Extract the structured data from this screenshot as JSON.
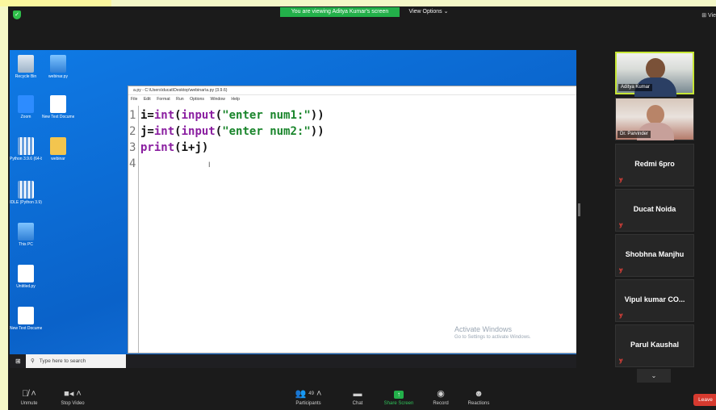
{
  "topbar": {
    "banner": "You are viewing Aditya Kumar's screen",
    "view_options": "View Options ⌄",
    "view_right": "⊞ Vie"
  },
  "desktop": {
    "icons": [
      {
        "label": "Recycle Bin"
      },
      {
        "label": "webinar.py"
      },
      {
        "label": "Zoom"
      },
      {
        "label": "New Text Document"
      },
      {
        "label": "Python 3.9.6 (64-bit)"
      },
      {
        "label": "webinar"
      },
      {
        "label": "IDLE (Python 3.9)"
      },
      {
        "label": "This PC"
      },
      {
        "label": "Untitled.py"
      },
      {
        "label": "New Text Document"
      }
    ],
    "search_placeholder": "Type here to search"
  },
  "idle": {
    "title": "a.py - C:\\Users\\ducat\\Desktop\\webinar\\a.py (3.9.6)",
    "menu": [
      "File",
      "Edit",
      "Format",
      "Run",
      "Options",
      "Window",
      "Help"
    ],
    "line_numbers": [
      "1",
      "2",
      "3",
      "4"
    ],
    "lines": {
      "l1a": "i=",
      "l1b": "int",
      "l1c": "(",
      "l1d": "input",
      "l1e": "(",
      "l1f": "\"enter num1:\"",
      "l1g": "))",
      "l2a": "j=",
      "l2b": "int",
      "l2c": "(",
      "l2d": "input",
      "l2e": "(",
      "l2f": "\"enter num2:\"",
      "l2g": "))",
      "l3a": "print",
      "l3b": "(i+j)"
    },
    "cursor": "I"
  },
  "watermark": {
    "line1": "Activate Windows",
    "line2": "Go to Settings to activate Windows."
  },
  "participants": [
    {
      "name": "Aditya Kumar",
      "video": true
    },
    {
      "name": "Dr. Parvinder",
      "video": true
    },
    {
      "name": "Redmi 6pro",
      "video": false
    },
    {
      "name": "Ducat Noida",
      "video": false
    },
    {
      "name": "Shobhna Manjhu",
      "video": false
    },
    {
      "name": "Vipul kumar CO...",
      "video": false
    },
    {
      "name": "Parul Kaushal",
      "video": false
    }
  ],
  "toolbar": {
    "unmute": "Unmute",
    "stop_video": "Stop Video",
    "participants": "Participants",
    "participant_count": "49",
    "chat": "Chat",
    "share_screen": "Share Screen",
    "record": "Record",
    "reactions": "Reactions",
    "leave": "Leave",
    "scroll_down": "⌄"
  },
  "colors": {
    "banner_green": "#23b04a",
    "active_speaker": "#c6e636",
    "leave_red": "#d63a2f",
    "desktop_blue": "#0f7ae5"
  }
}
